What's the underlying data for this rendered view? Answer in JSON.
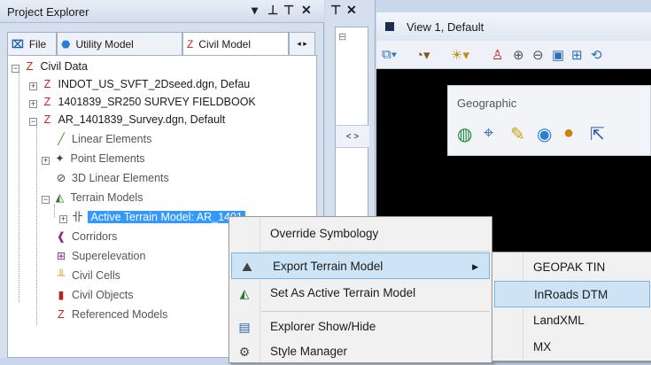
{
  "project_explorer": {
    "title": "Project Explorer",
    "tabs": [
      {
        "label": "File",
        "icon": "file-tab-icon"
      },
      {
        "label": "Utility Model",
        "icon": "utility-model-icon"
      },
      {
        "label": "Civil Model",
        "icon": "civil-model-icon"
      }
    ],
    "tree": {
      "root": "Civil Data",
      "files": [
        "INDOT_US_SVFT_2Dseed.dgn, Defau",
        "1401839_SR250 SURVEY FIELDBOOK",
        "AR_1401839_Survey.dgn, Default"
      ],
      "children": [
        "Linear Elements",
        "Point Elements",
        "3D Linear Elements",
        "Terrain Models",
        "Active Terrain Model: AR_1401",
        "Corridors",
        "Superelevation",
        "Civil Cells",
        "Civil Objects",
        "Referenced Models"
      ]
    }
  },
  "view": {
    "title": "View 1, Default",
    "geographic_label": "Geographic"
  },
  "context_menu": {
    "items": [
      {
        "label": "Override Symbology",
        "icon": ""
      },
      {
        "label": "Export Terrain Model",
        "icon": "export-terrain-icon",
        "submenu": true
      },
      {
        "label": "Set As Active Terrain Model",
        "icon": "set-active-terrain-icon"
      },
      {
        "label": "Explorer Show/Hide",
        "icon": "explorer-show-hide-icon"
      },
      {
        "label": "Style Manager",
        "icon": "style-manager-icon"
      }
    ]
  },
  "submenu": {
    "items": [
      "GEOPAK TIN",
      "InRoads DTM",
      "LandXML",
      "MX"
    ]
  },
  "colors": {
    "selection": "#3399ff",
    "menu_highlight": "#cde4f7",
    "canvas": "#000000"
  }
}
